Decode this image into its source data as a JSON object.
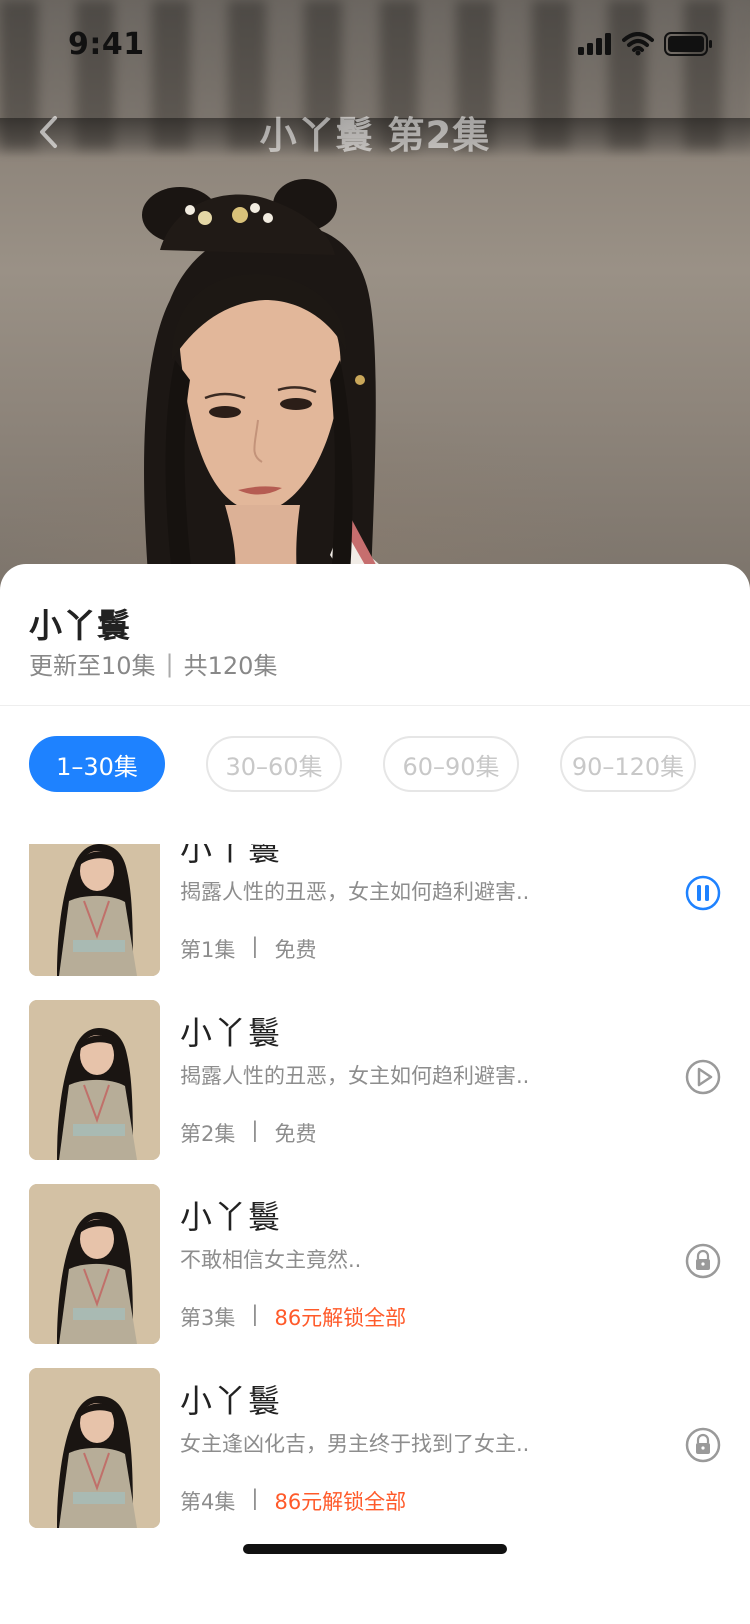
{
  "status_bar": {
    "time": "9:41"
  },
  "nav": {
    "title": "小丫鬟 第2集"
  },
  "drama": {
    "title": "小丫鬟",
    "update_status": "更新至10集",
    "total": "共120集",
    "separator": "|"
  },
  "tabs": [
    {
      "label": "1–30集",
      "active": true
    },
    {
      "label": "30–60集",
      "active": false
    },
    {
      "label": "60–90集",
      "active": false
    },
    {
      "label": "90–120集",
      "active": false
    }
  ],
  "episodes": [
    {
      "title": "小丫鬟",
      "description": "揭露人性的丑恶，女主如何趋利避害..",
      "episode": "第1集",
      "separator": "|",
      "price": "免费",
      "locked": false,
      "action_icon": "pause-icon"
    },
    {
      "title": "小丫鬟",
      "description": "揭露人性的丑恶，女主如何趋利避害..",
      "episode": "第2集",
      "separator": "|",
      "price": "免费",
      "locked": false,
      "action_icon": "play-icon"
    },
    {
      "title": "小丫鬟",
      "description": "不敢相信女主竟然..",
      "episode": "第3集",
      "separator": "|",
      "price": "86元解锁全部",
      "locked": true,
      "action_icon": "lock-icon"
    },
    {
      "title": "小丫鬟",
      "description": "女主逢凶化吉，男主终于找到了女主..",
      "episode": "第4集",
      "separator": "|",
      "price": "86元解锁全部",
      "locked": true,
      "action_icon": "lock-icon"
    }
  ],
  "colors": {
    "accent": "#1e82ff",
    "locked_price": "#ff5a2a",
    "inactive_tab_text": "#c8c8c8",
    "secondary_text": "#8d8d8d"
  }
}
